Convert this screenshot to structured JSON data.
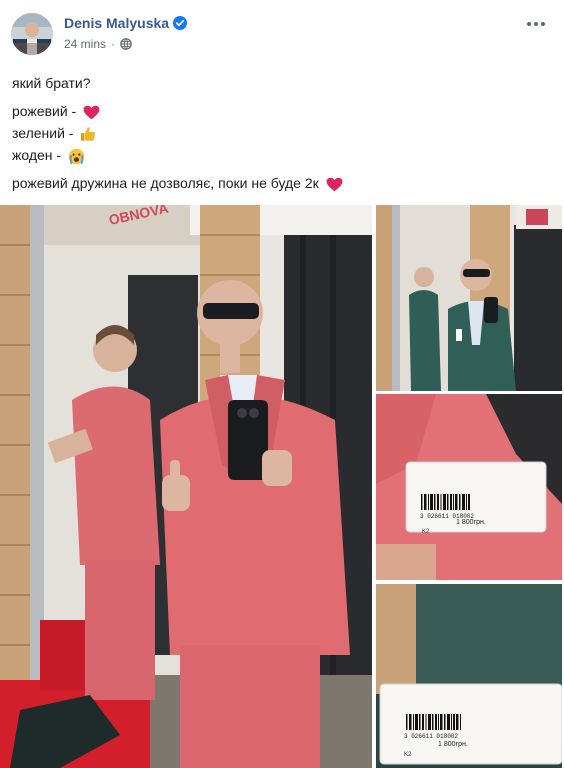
{
  "post": {
    "author": "Denis Malyuska",
    "time": "24 mins",
    "separator": "·",
    "privacy_icon": "globe-icon",
    "verified_icon": "verified-badge-icon",
    "more_icon": "ellipsis-icon",
    "lines": {
      "question": "який брати?",
      "pink": "рожевий - ",
      "green": "зелений - ",
      "none": "жоден - ",
      "final": "рожевий дружина не дозволяє, поки не буде 2к "
    },
    "emoji": {
      "pink": "red-heart",
      "green": "thumbs-up",
      "none": "crying-face",
      "final": "red-heart"
    }
  },
  "photos": {
    "sign_text": "OBNOVA",
    "tag1": {
      "barcode": "3 026611 018002",
      "size": "K2",
      "price": "1 800грн."
    },
    "tag2": {
      "barcode": "3 026611 018002",
      "size": "K2",
      "price": "1 800грн."
    }
  },
  "colors": {
    "link": "#385898",
    "meta": "#606770",
    "text": "#1c1e21",
    "verified": "#1877f2",
    "pink_suit": "#e16a72",
    "green_suit": "#2f5e57",
    "heart": "#e0245e"
  }
}
